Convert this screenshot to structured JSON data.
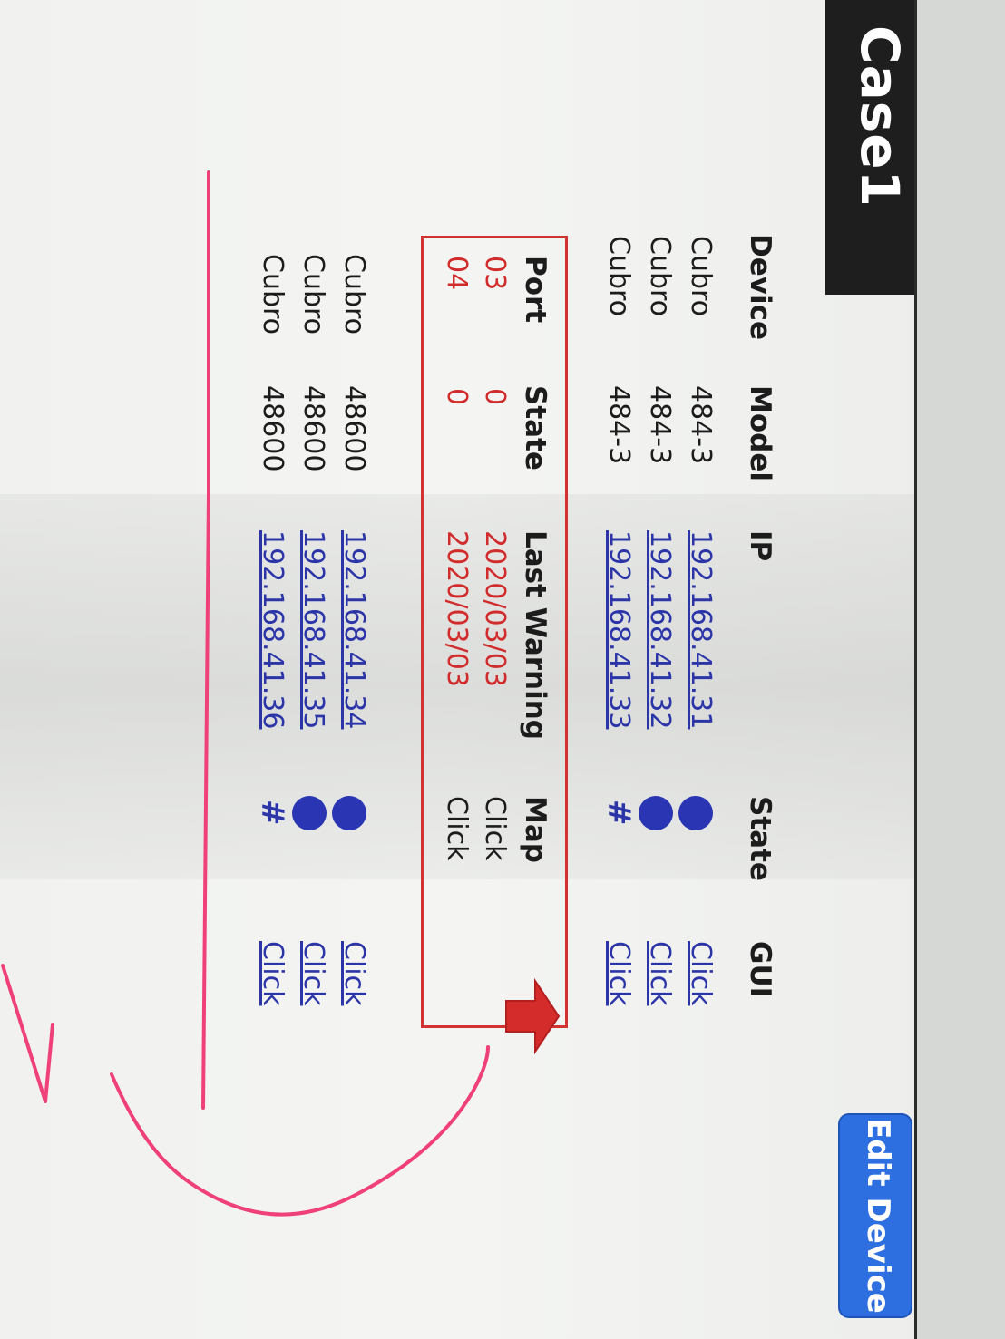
{
  "page": {
    "title": "Case1"
  },
  "toolbar": {
    "edit_label": "Edit Device"
  },
  "device_table": {
    "headers": {
      "device": "Device",
      "model": "Model",
      "ip": "IP",
      "state": "State",
      "gui": "GUI"
    },
    "rows": [
      {
        "device": "Cubro",
        "model": "484-3",
        "ip": "192.168.41.31",
        "state": "dot",
        "gui": "Click"
      },
      {
        "device": "Cubro",
        "model": "484-3",
        "ip": "192.168.41.32",
        "state": "dot",
        "gui": "Click"
      },
      {
        "device": "Cubro",
        "model": "484-3",
        "ip": "192.168.41.33",
        "state": "#",
        "gui": "Click"
      }
    ]
  },
  "port_table": {
    "headers": {
      "port": "Port",
      "state": "State",
      "last_warning": "Last Warning",
      "map": "Map"
    },
    "rows": [
      {
        "port": "03",
        "state": "0",
        "last_warning": "2020/03/03",
        "map": "Click"
      },
      {
        "port": "04",
        "state": "0",
        "last_warning": "2020/03/03",
        "map": "Click"
      }
    ]
  },
  "device_table_2": {
    "rows": [
      {
        "device": "Cubro",
        "model": "48600",
        "ip": "192.168.41.34",
        "state": "dot",
        "gui": "Click"
      },
      {
        "device": "Cubro",
        "model": "48600",
        "ip": "192.168.41.35",
        "state": "dot",
        "gui": "Click"
      },
      {
        "device": "Cubro",
        "model": "48600",
        "ip": "192.168.41.36",
        "state": "#",
        "gui": "Click"
      }
    ]
  },
  "colors": {
    "link": "#2c35a8",
    "warning": "#d12b2b",
    "status_dot": "#2a35b3",
    "edit_button": "#2d6fe0",
    "annotation_pen": "#f0407a"
  },
  "icons": {
    "state_ok": "filled-circle-icon",
    "state_unknown": "hash-icon",
    "insert_arrow": "left-arrow-icon"
  }
}
